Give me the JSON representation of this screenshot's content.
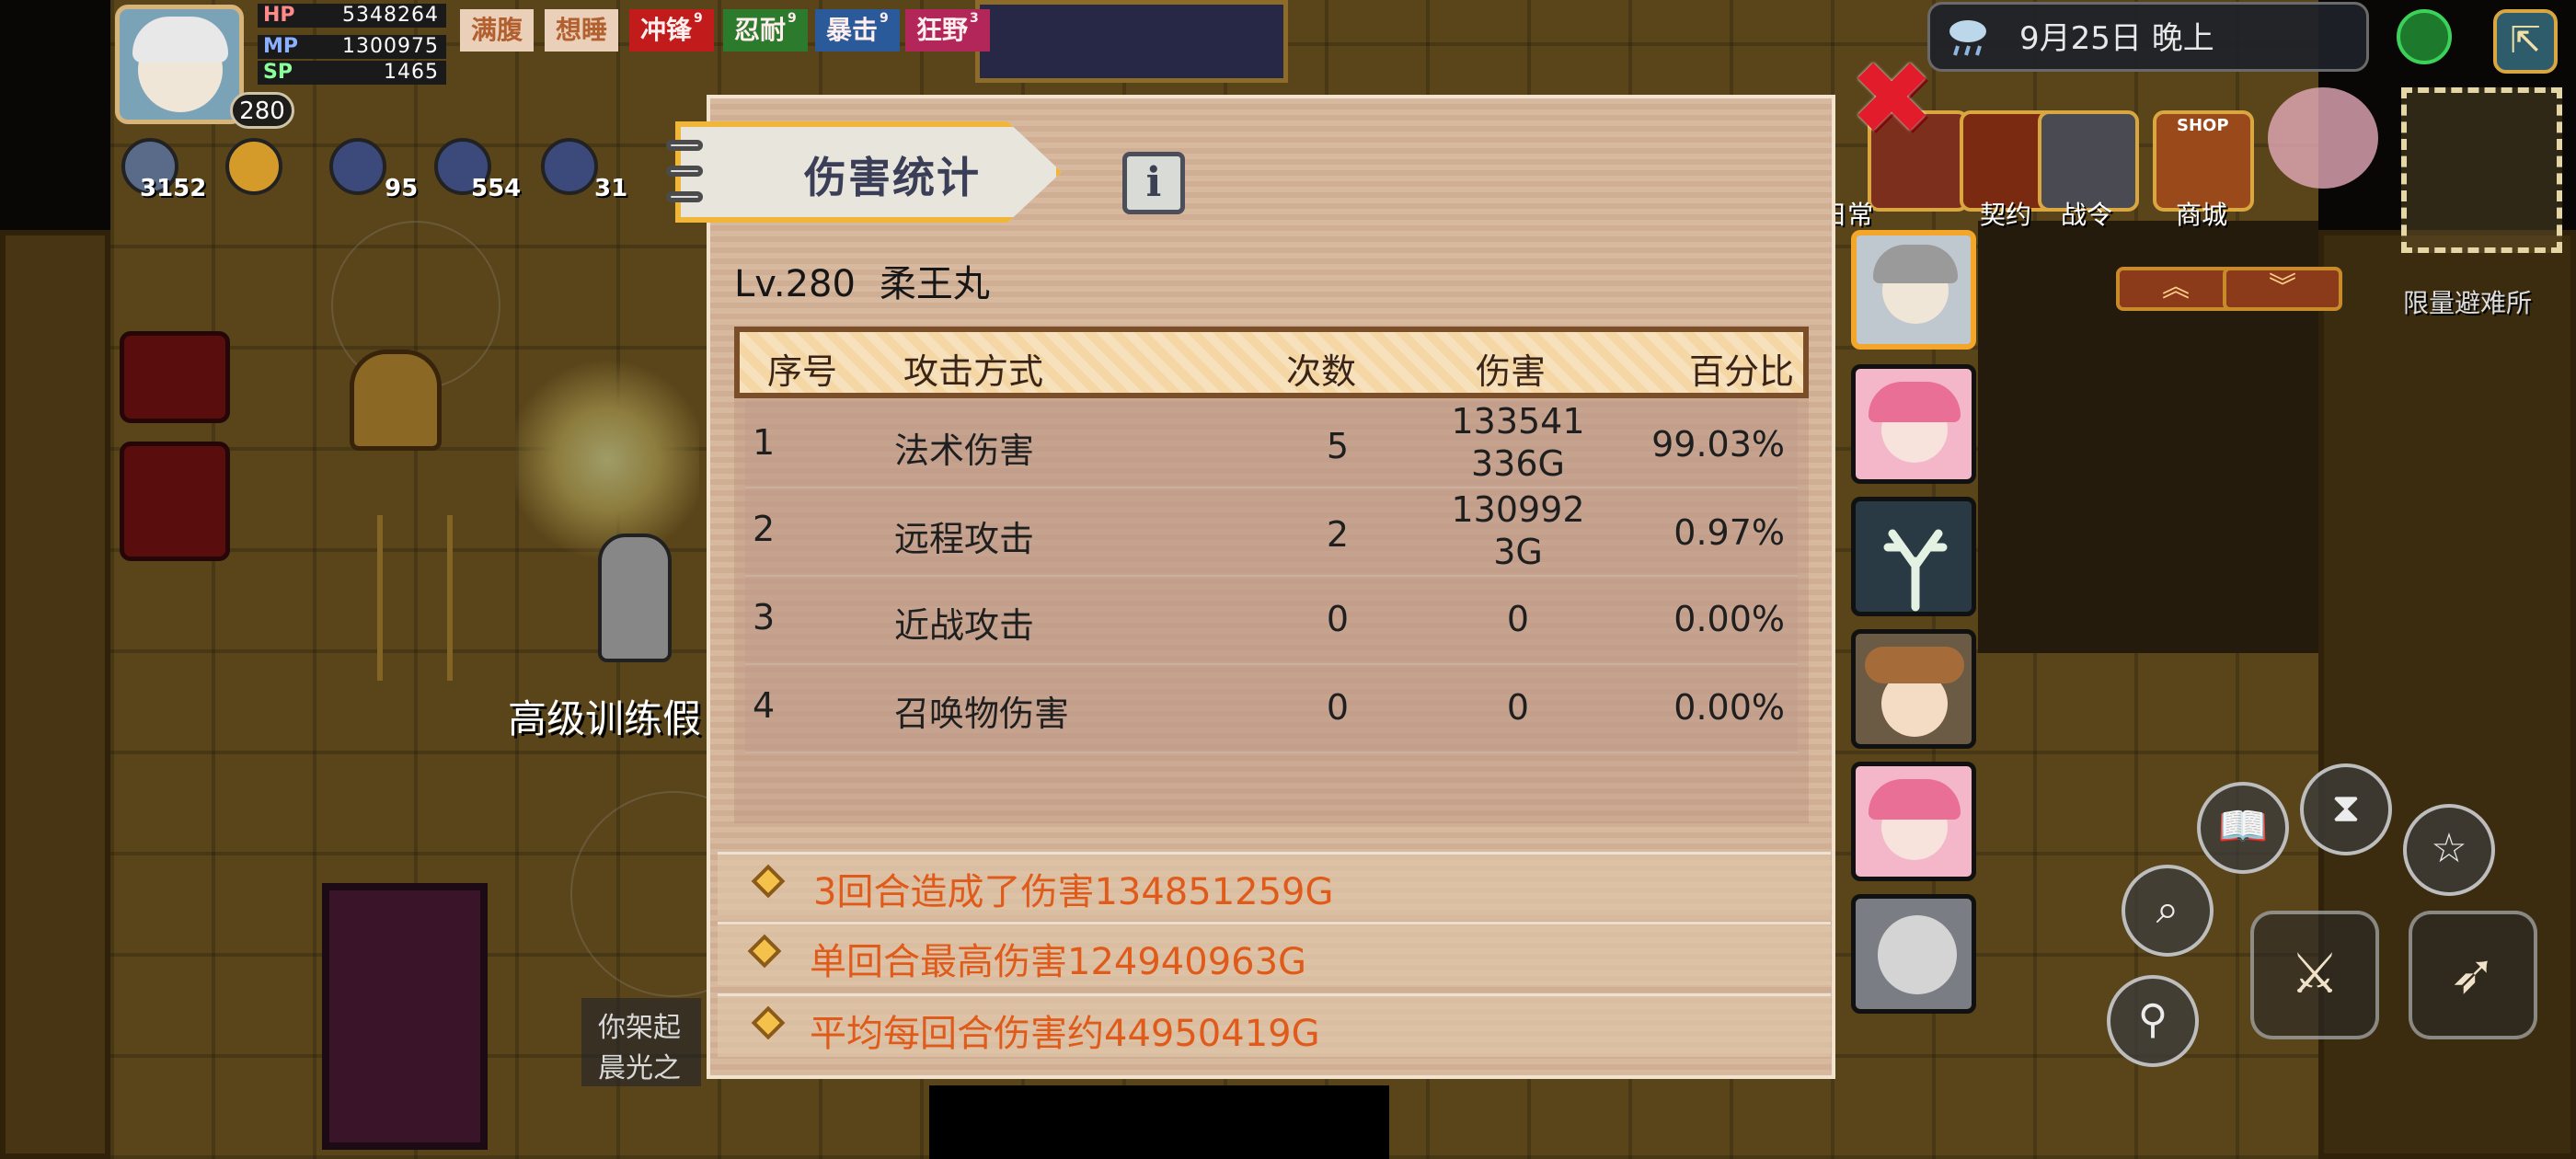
{
  "hud": {
    "level": "280",
    "stats": [
      {
        "key": "HP",
        "value": "5348264",
        "color": "#c22d2d"
      },
      {
        "key": "MP",
        "value": "1300975",
        "color": "#2d5bc2"
      },
      {
        "key": "SP",
        "value": "1465",
        "color": "#2d9a3a"
      }
    ],
    "buffs": [
      {
        "label": "满腹",
        "level": "",
        "color": "#b87038"
      },
      {
        "label": "想睡",
        "level": "",
        "color": "#b87038"
      },
      {
        "label": "冲锋",
        "level": "9",
        "color": "#c11b1b"
      },
      {
        "label": "忍耐",
        "level": "9",
        "color": "#2c7a2c"
      },
      {
        "label": "暴击",
        "level": "9",
        "color": "#2a5a9a"
      },
      {
        "label": "狂野",
        "level": "3",
        "color": "#b3265a"
      }
    ],
    "resources": [
      "3152",
      "",
      "95",
      "554",
      "31"
    ]
  },
  "topbar": {
    "date": "9月25日  晚上",
    "menu": [
      "日常",
      "契约",
      "战令",
      "商城"
    ],
    "shop_tag": "SHOP",
    "shelter_label": "限量避难所"
  },
  "scene": {
    "training_label": "高级训练假",
    "log_lines": [
      "你架起",
      "晨光之"
    ]
  },
  "panel": {
    "title": "伤害统计",
    "info_label": "i",
    "close_label": "✖",
    "char_level": "Lv.280",
    "char_name": "柔王丸",
    "columns": [
      "序号",
      "攻击方式",
      "次数",
      "伤害",
      "百分比"
    ],
    "rows": [
      {
        "no": "1",
        "type": "法术伤害",
        "count": "5",
        "damage_1": "133541",
        "damage_2": "336G",
        "percent": "99.03%"
      },
      {
        "no": "2",
        "type": "远程攻击",
        "count": "2",
        "damage_1": "130992",
        "damage_2": "3G",
        "percent": "0.97%"
      },
      {
        "no": "3",
        "type": "近战攻击",
        "count": "0",
        "damage_1": "0",
        "damage_2": "",
        "percent": "0.00%"
      },
      {
        "no": "4",
        "type": "召唤物伤害",
        "count": "0",
        "damage_1": "0",
        "damage_2": "",
        "percent": "0.00%"
      }
    ],
    "summary": [
      "3回合造成了伤害134851259G",
      "单回合最高伤害124940963G",
      "平均每回合伤害约44950419G"
    ]
  },
  "controls": {
    "up_arrow": "︽",
    "down_arrow": "︾",
    "book_icon": "📖",
    "hourglass_icon": "⧗",
    "star_icon": "☆",
    "search_icon": "⌕",
    "zoom_icon": "⚲",
    "sword_icon": "⚔",
    "bow_icon": "➶",
    "exit_icon": "⇱"
  },
  "colors": {
    "accent_orange": "#e05a1a",
    "panel_border": "#f0b63a",
    "close_red": "#e21c2a",
    "selected_slot": "#f3a62a"
  }
}
